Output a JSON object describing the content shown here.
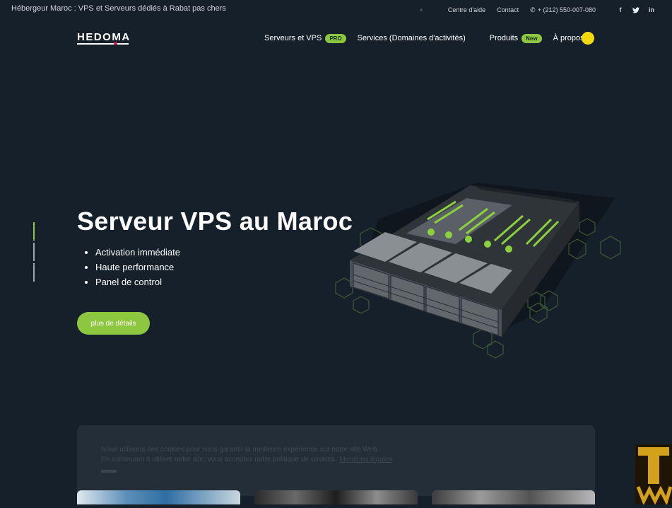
{
  "topbar": {
    "title": "Hébergeur Maroc : VPS et Serveurs dédiés à Rabat pas chers",
    "help": "Centre d'aide",
    "contact": "Contact",
    "phone": "+ (212) 550-007-080",
    "social": [
      "f",
      "t",
      "in"
    ]
  },
  "nav": {
    "logo": "HEDOMA",
    "items": [
      {
        "label": "Serveurs et VPS",
        "badge": "PRO"
      },
      {
        "label": "Services (Domaines d'activités)"
      },
      {
        "label": "Produits",
        "badge": "New"
      },
      {
        "label": "À propos"
      }
    ]
  },
  "hero": {
    "title": "Serveur VPS au Maroc",
    "features": [
      "Activation immédiate",
      "Haute performance",
      "Panel de control"
    ],
    "cta": "plus de détails"
  },
  "cookie": {
    "line1": "Nous utilisons des cookies pour vous garantir la meilleure expérience sur notre site Web.",
    "line2": "En continuant à utiliser notre site, vous acceptez notre politique de cookies.",
    "more": "Mentions légales"
  },
  "colors": {
    "background": "#16202a",
    "accent": "#8dc63f",
    "toggle": "#f5d90a"
  }
}
